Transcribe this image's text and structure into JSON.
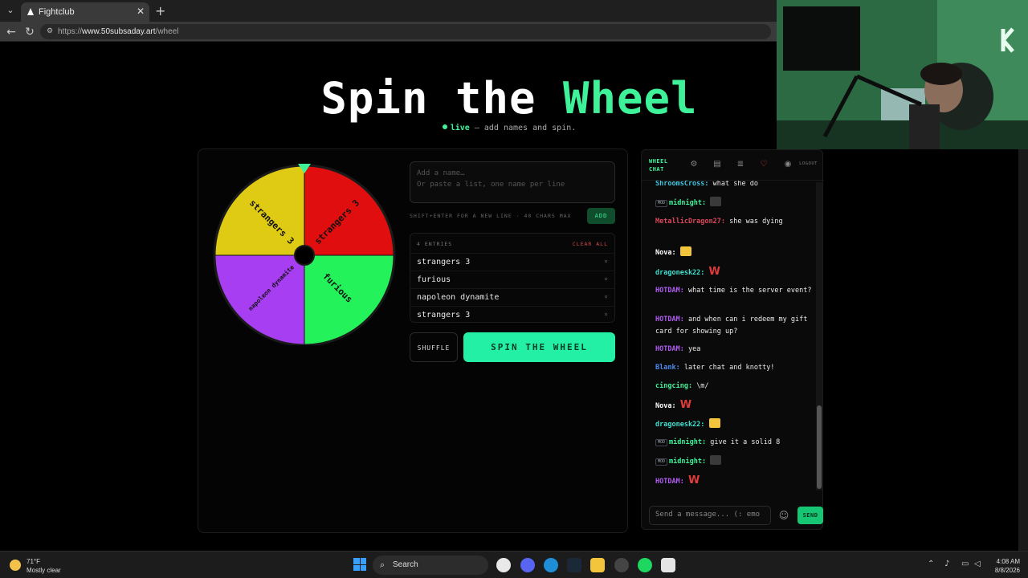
{
  "browser": {
    "tab_title": "Fightclub",
    "url_prefix": "https://",
    "url_domain": "www.50subsaday.art",
    "url_path": "/wheel"
  },
  "hero": {
    "title_main": "Spin the ",
    "title_accent": "Wheel",
    "live_label": "live",
    "subtitle": " — add names and spin."
  },
  "wheel": {
    "segments": [
      {
        "label": "strangers 3",
        "color": "#e00e0e"
      },
      {
        "label": "furious",
        "color": "#24f25a"
      },
      {
        "label": "napoleon dynamite",
        "color": "#a83ef2"
      },
      {
        "label": "strangers 3",
        "color": "#dfcb13"
      }
    ]
  },
  "form": {
    "placeholder": "Add a name…\nOr paste a list, one name per line",
    "hint": "SHIFT+ENTER FOR A NEW LINE · 40 CHARS MAX",
    "add_label": "ADD"
  },
  "entries": {
    "count_label": "4 ENTRIES",
    "clear_label": "CLEAR ALL",
    "items": [
      "strangers 3",
      "furious",
      "napoleon dynamite",
      "strangers 3"
    ],
    "remove_glyph": "×"
  },
  "actions": {
    "shuffle_label": "SHUFFLE",
    "spin_label": "SPIN THE WHEEL"
  },
  "chat": {
    "title_line1": "WHEEL",
    "title_line2": "CHAT",
    "logout_label": "LOGOUT",
    "mod_badge": "MOD",
    "messages": [
      {
        "user": "ShroomsCross:",
        "text": "what she do",
        "color": "#3ec7e0"
      },
      {
        "user": "midnight:",
        "text": "",
        "color": "#3ef29a",
        "mod": true
      },
      {
        "user": "MetallicDragon27:",
        "text": "she was dying",
        "color": "#d9475a"
      },
      {
        "user": "Nova:",
        "text": "",
        "color": "#ffffff"
      },
      {
        "user": "dragonesk22:",
        "text": "W",
        "color": "#3ee0d0"
      },
      {
        "user": "HOTDAM:",
        "text": "what time is the server event?",
        "color": "#b05cf2"
      },
      {
        "user": "HOTDAM:",
        "text": "and when can i redeem my gift card for showing up?",
        "color": "#b05cf2"
      },
      {
        "user": "HOTDAM:",
        "text": "yea",
        "color": "#b05cf2"
      },
      {
        "user": "Blank:",
        "text": "later chat and knotty!",
        "color": "#4a8cf2"
      },
      {
        "user": "cingcing:",
        "text": "\\m/",
        "color": "#3ef29a"
      },
      {
        "user": "Nova:",
        "text": "W",
        "color": "#ffffff"
      },
      {
        "user": "dragonesk22:",
        "text": "",
        "color": "#3ee0d0"
      },
      {
        "user": "midnight:",
        "text": "give it a solid 8",
        "color": "#3ef29a",
        "mod": true
      },
      {
        "user": "midnight:",
        "text": "",
        "color": "#3ef29a",
        "mod": true
      },
      {
        "user": "HOTDAM:",
        "text": "W",
        "color": "#b05cf2"
      }
    ],
    "input_placeholder": "Send a message... (: emo",
    "send_label": "SEND"
  },
  "taskbar": {
    "temperature": "71°F",
    "condition": "Mostly clear",
    "search_label": "Search",
    "time": "4:08 AM",
    "date": "8/8/2026"
  },
  "colors": {
    "accent": "#3ef29a",
    "spin_button": "#23f0a4"
  }
}
